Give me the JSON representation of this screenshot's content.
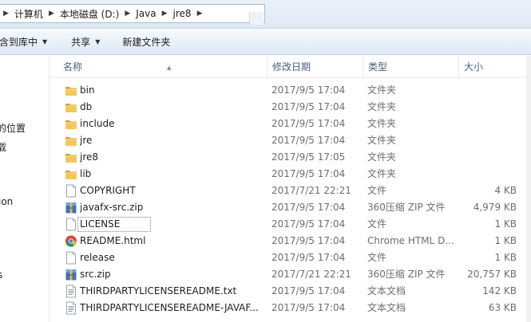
{
  "address": {
    "crumbs": [
      "计算机",
      "本地磁盘 (D:)",
      "Java",
      "jre8"
    ]
  },
  "toolbar": {
    "include_label": "含到库中",
    "share_label": "共享",
    "new_folder_label": "新建文件夹"
  },
  "nav": {
    "items": [
      "的位置",
      "载",
      "ion",
      "s"
    ]
  },
  "columns": {
    "name": "名称",
    "date": "修改日期",
    "type": "类型",
    "size": "大小"
  },
  "files": [
    {
      "name": "bin",
      "date": "2017/9/5 17:04",
      "type": "文件夹",
      "size": "",
      "icon": "folder-icon"
    },
    {
      "name": "db",
      "date": "2017/9/5 17:04",
      "type": "文件夹",
      "size": "",
      "icon": "folder-icon"
    },
    {
      "name": "include",
      "date": "2017/9/5 17:04",
      "type": "文件夹",
      "size": "",
      "icon": "folder-icon"
    },
    {
      "name": "jre",
      "date": "2017/9/5 17:04",
      "type": "文件夹",
      "size": "",
      "icon": "folder-icon"
    },
    {
      "name": "jre8",
      "date": "2017/9/5 17:05",
      "type": "文件夹",
      "size": "",
      "icon": "folder-icon"
    },
    {
      "name": "lib",
      "date": "2017/9/5 17:04",
      "type": "文件夹",
      "size": "",
      "icon": "folder-icon"
    },
    {
      "name": "COPYRIGHT",
      "date": "2017/7/21 22:21",
      "type": "文件",
      "size": "4 KB",
      "icon": "file-icon"
    },
    {
      "name": "javafx-src.zip",
      "date": "2017/9/5 17:04",
      "type": "360压缩 ZIP 文件",
      "size": "4,979 KB",
      "icon": "zip-archive-icon"
    },
    {
      "name": "LICENSE",
      "date": "2017/9/5 17:04",
      "type": "文件",
      "size": "1 KB",
      "icon": "file-icon"
    },
    {
      "name": "README.html",
      "date": "2017/9/5 17:04",
      "type": "Chrome HTML D...",
      "size": "1 KB",
      "icon": "chrome-icon"
    },
    {
      "name": "release",
      "date": "2017/9/5 17:04",
      "type": "文件",
      "size": "1 KB",
      "icon": "file-icon"
    },
    {
      "name": "src.zip",
      "date": "2017/7/21 22:21",
      "type": "360压缩 ZIP 文件",
      "size": "20,757 KB",
      "icon": "zip-archive-icon"
    },
    {
      "name": "THIRDPARTYLICENSEREADME.txt",
      "date": "2017/9/5 17:04",
      "type": "文本文档",
      "size": "142 KB",
      "icon": "text-file-icon"
    },
    {
      "name": "THIRDPARTYLICENSEREADME-JAVAF...",
      "date": "2017/9/5 17:04",
      "type": "文本文档",
      "size": "63 KB",
      "icon": "text-file-icon"
    }
  ],
  "selected_file": "LICENSE",
  "colors": {
    "folder": "#e8b63c",
    "header_text": "#4c607a",
    "meta_text": "#6d6d6d"
  }
}
